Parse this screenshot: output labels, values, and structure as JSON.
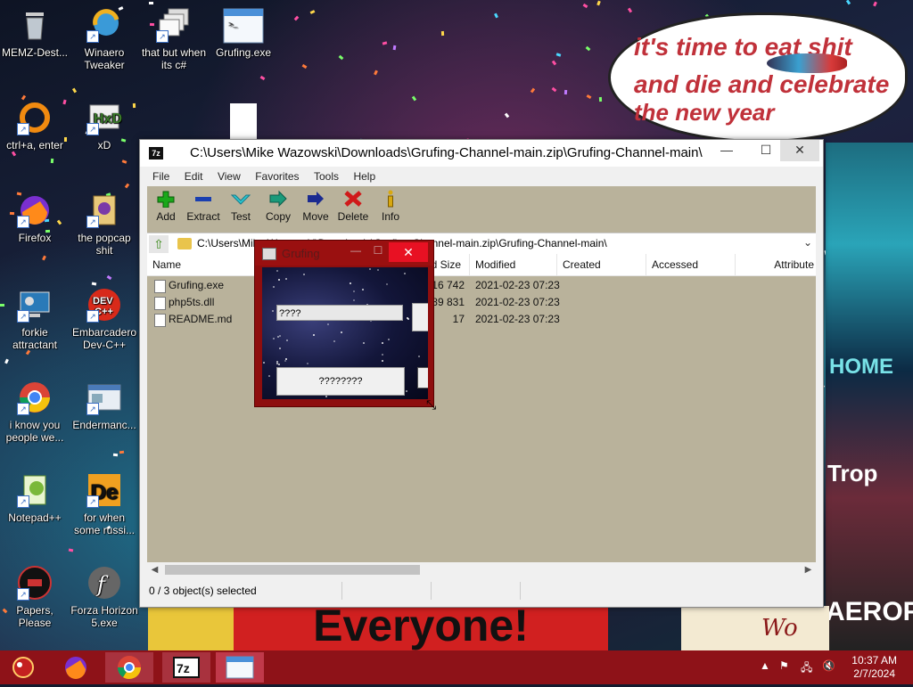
{
  "desktop": {
    "icons": [
      {
        "label": "MEMZ-Dest...",
        "icon": "recycle-bin-icon"
      },
      {
        "label": "Winaero Tweaker",
        "icon": "winaero-icon"
      },
      {
        "label": "that but when its c#",
        "icon": "stacked-windows-icon"
      },
      {
        "label": "Grufing.exe",
        "icon": "app-window-icon"
      },
      {
        "label": "ctrl+a, enter",
        "icon": "orange-ring-icon"
      },
      {
        "label": "xD",
        "icon": "hxd-icon"
      },
      {
        "label": "Firefox",
        "icon": "firefox-icon"
      },
      {
        "label": "the popcap shit",
        "icon": "popcap-icon"
      },
      {
        "label": "forkie attractant",
        "icon": "settings-monitor-icon"
      },
      {
        "label": "Embarcadero Dev-C++",
        "icon": "devcpp-icon"
      },
      {
        "label": "i know you people we...",
        "icon": "chrome-icon"
      },
      {
        "label": "Endermanc...",
        "icon": "window-app-icon"
      },
      {
        "label": "Notepad++",
        "icon": "notepadpp-icon"
      },
      {
        "label": "for when some russi...",
        "icon": "de-icon"
      },
      {
        "label": "Papers, Please",
        "icon": "papers-please-icon"
      },
      {
        "label": "Forza Horizon 5.exe",
        "icon": "flash-icon"
      }
    ],
    "wallpaper": {
      "bubble_lines": [
        "it's time to eat shit",
        "and die and celebrate",
        "the new year"
      ],
      "sign_text": "Everyone!",
      "right_text_1": "HOME",
      "right_text_2": "Trop",
      "right_text_3": "AEROFO",
      "bottom_right_text": "Wo"
    }
  },
  "zip_window": {
    "title": "C:\\Users\\Mike Wazowski\\Downloads\\Grufing-Channel-main.zip\\Grufing-Channel-main\\",
    "app_icon": "7z",
    "controls": {
      "minimize": "—",
      "maximize": "☐",
      "close": "✕"
    },
    "menu": [
      "File",
      "Edit",
      "View",
      "Favorites",
      "Tools",
      "Help"
    ],
    "toolbar": [
      {
        "label": "Add",
        "icon": "plus-icon",
        "color": "#1aa81a"
      },
      {
        "label": "Extract",
        "icon": "minus-icon",
        "color": "#1a3fb0"
      },
      {
        "label": "Test",
        "icon": "check-icon",
        "color": "#2aa8b8"
      },
      {
        "label": "Copy",
        "icon": "double-arrow-icon",
        "color": "#1a8a6a"
      },
      {
        "label": "Move",
        "icon": "arrow-right-icon",
        "color": "#1a2a90"
      },
      {
        "label": "Delete",
        "icon": "x-icon",
        "color": "#d01a1a"
      },
      {
        "label": "Info",
        "icon": "info-icon",
        "color": "#d8a810"
      }
    ],
    "address": "C:\\Users\\Mike Wazowski\\Downloads\\Grufing-Channel-main.zip\\Grufing-Channel-main\\",
    "columns": [
      "Name",
      "Size",
      "Packed Size",
      "Modified",
      "Created",
      "Accessed",
      "Attributes"
    ],
    "visible_columns": {
      "name": "Name",
      "packed": "ed Size",
      "modified": "Modified",
      "created": "Created",
      "accessed": "Accessed",
      "attributes": "Attribute"
    },
    "files": [
      {
        "name": "Grufing.exe",
        "packed": "16 742",
        "modified": "2021-02-23 07:23"
      },
      {
        "name": "php5ts.dll",
        "packed": "89 831",
        "modified": "2021-02-23 07:23"
      },
      {
        "name": "README.md",
        "packed": "17",
        "modified": "2021-02-23 07:23"
      }
    ],
    "status": "0 / 3 object(s) selected"
  },
  "gruf_window": {
    "title": "Grufing",
    "input_value": "????",
    "button_label": "????????",
    "close": "✕"
  },
  "taskbar": {
    "items": [
      "start-orb",
      "firefox",
      "chrome",
      "7-zip",
      "grufing"
    ],
    "time": "10:37 AM",
    "date": "2/7/2024",
    "accent": "#8e1218"
  }
}
